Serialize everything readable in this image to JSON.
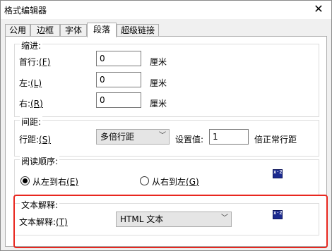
{
  "window": {
    "title": "格式编辑器",
    "close_glyph": "✕"
  },
  "tabs": [
    {
      "label": "公用"
    },
    {
      "label": "边框"
    },
    {
      "label": "字体"
    },
    {
      "label": "段落",
      "active": true
    },
    {
      "label": "超级链接"
    }
  ],
  "indent": {
    "legend": "缩进:",
    "first_line": {
      "label": "首行:",
      "key": "(F)",
      "value": "0",
      "unit": "厘米"
    },
    "left": {
      "label": "左:",
      "key": "(L)",
      "value": "0",
      "unit": "厘米"
    },
    "right": {
      "label": "右:",
      "key": "(R)",
      "value": "0",
      "unit": "厘米"
    }
  },
  "spacing": {
    "legend": "间距:",
    "line_label": "行距:",
    "line_key": "(S)",
    "line_value": "多倍行距",
    "set_label": "设置值:",
    "set_value": "1",
    "set_suffix": "倍正常行距"
  },
  "reading": {
    "legend": "阅读顺序:",
    "ltr_label": "从左到右",
    "ltr_key": "(E)",
    "rtl_label": "从右到左",
    "rtl_key": "(G)",
    "selected": "ltr",
    "icon_text": "x·2"
  },
  "text_interp": {
    "legend": "文本解释:",
    "label": "文本解释:",
    "key": "(T)",
    "value": "HTML 文本",
    "icon_text": "x·2"
  },
  "colors": {
    "highlight": "#e8271f"
  }
}
